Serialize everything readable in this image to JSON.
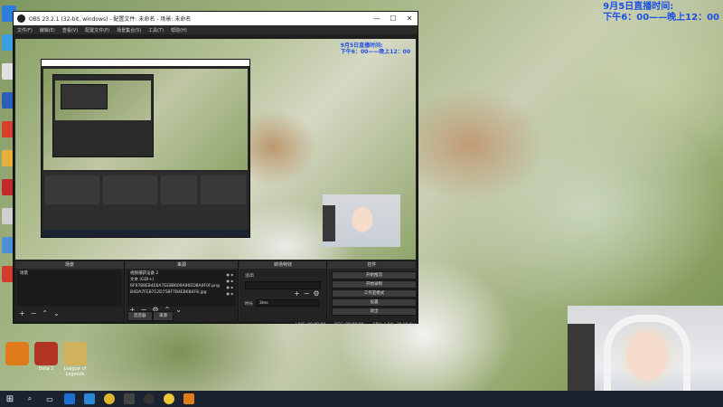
{
  "overlay": {
    "line1": "9月5日直播时间:",
    "line2": "下午6：00——晚上12：00"
  },
  "obs": {
    "title": "OBS 23.2.1 (32-bit, windows) - 配置文件: 未命名 - 场景: 未命名",
    "window_controls": {
      "minimize": "—",
      "maximize": "☐",
      "close": "✕"
    },
    "menu": [
      "文件(F)",
      "编辑(E)",
      "查看(V)",
      "配置文件(P)",
      "场景集合(S)",
      "工具(T)",
      "帮助(H)"
    ],
    "docks": {
      "scenes": {
        "title": "场景",
        "items": [
          "场景"
        ]
      },
      "sources": {
        "title": "来源",
        "items": [
          {
            "name": "视频捕获设备 2",
            "selected": false
          },
          {
            "name": "文本 (GDI+)",
            "selected": false
          },
          {
            "name": "6F9788EB4E6A7EE8B609A96ED8A0F0F.png",
            "selected": false
          },
          {
            "name": "B4DA7FE8712D75BF7B4EB6B4F8.jpg",
            "selected": false
          }
        ],
        "tabs": [
          "混音器",
          "来源"
        ]
      },
      "transitions": {
        "title": "转场特效",
        "type": "淡出",
        "duration_label": "时长",
        "duration_value": "3ms"
      },
      "controls": {
        "title": "控件",
        "buttons": [
          "开始推流",
          "开始录制",
          "工作室模式",
          "设置",
          "退出"
        ]
      }
    },
    "status": {
      "live": "LIVE: 00:00:00",
      "rec": "REC: 00:00:00",
      "cpu": "CPU: 1.5%, 30.00 fps"
    }
  },
  "taskbar": {
    "items": [
      "windows-start",
      "search",
      "task-view",
      "app-1",
      "edge",
      "chrome",
      "app-2",
      "obs",
      "app-3",
      "app-4"
    ]
  },
  "desktop_icons_bottom": [
    {
      "label": "",
      "color": "#e07b1c"
    },
    {
      "label": "Dota 2",
      "color": "#b23424"
    },
    {
      "label": "League of Legends",
      "color": "#d1b25c"
    }
  ],
  "colors": {
    "overlay_text": "#1d4fe6",
    "obs_bg": "#1e1e1e",
    "taskbar": "#1b2230"
  }
}
